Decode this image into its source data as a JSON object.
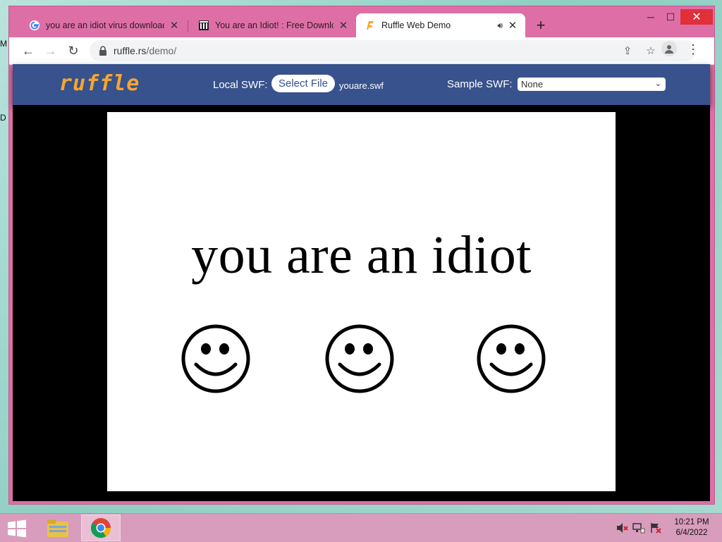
{
  "browser": {
    "tabs": [
      {
        "title": "you are an idiot virus download",
        "favicon": "google-icon",
        "active": false
      },
      {
        "title": "You are an Idiot! : Free Download",
        "favicon": "archive-icon",
        "active": false
      },
      {
        "title": "Ruffle Web Demo",
        "favicon": "ruffle-icon",
        "active": true
      }
    ],
    "address": {
      "host": "ruffle.rs",
      "path": "/demo/"
    }
  },
  "ruffle": {
    "logo": "ruffle",
    "local_label": "Local SWF:",
    "select_file": "Select File",
    "file_name": "youare.swf",
    "sample_label": "Sample SWF:",
    "sample_value": "None"
  },
  "stage": {
    "text": "you are an idiot",
    "smileys": [
      "smiley-face-icon",
      "smiley-face-icon",
      "smiley-face-icon"
    ]
  },
  "taskbar": {
    "time": "10:21 PM",
    "date": "6/4/2022"
  },
  "colors": {
    "window_frame": "#de6fa6",
    "ruffle_header": "#37528c",
    "ruffle_accent": "#f7a531",
    "close_button": "#e0303a"
  }
}
